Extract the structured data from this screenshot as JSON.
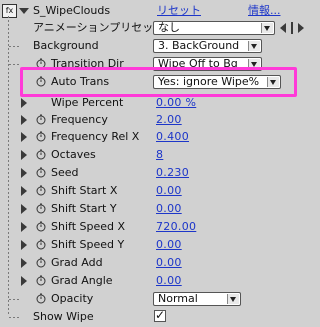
{
  "effect": {
    "name": "S_WipeClouds",
    "reset_label": "リセット",
    "info_label": "情報...",
    "preset_label": "アニメーションプリセット：",
    "preset_value": "なし",
    "nav_icons": [
      "preset-prev-icon",
      "preset-next-icon"
    ]
  },
  "params": {
    "background": {
      "label": "Background",
      "value": "3. BackGround"
    },
    "transition_dir": {
      "label": "Transition Dir",
      "value": "Wipe Off to Bg"
    },
    "auto_trans": {
      "label": "Auto Trans",
      "value": "Yes: ignore Wipe%"
    },
    "wipe_percent": {
      "label": "Wipe Percent",
      "value": "0.00 %"
    },
    "frequency": {
      "label": "Frequency",
      "value": "2.00"
    },
    "frequency_rel_x": {
      "label": "Frequency Rel X",
      "value": "0.400"
    },
    "octaves": {
      "label": "Octaves",
      "value": "8"
    },
    "seed": {
      "label": "Seed",
      "value": "0.230"
    },
    "shift_start_x": {
      "label": "Shift Start X",
      "value": "0.00"
    },
    "shift_start_y": {
      "label": "Shift Start Y",
      "value": "0.00"
    },
    "shift_speed_x": {
      "label": "Shift Speed X",
      "value": "720.00"
    },
    "shift_speed_y": {
      "label": "Shift Speed Y",
      "value": "0.00"
    },
    "grad_add": {
      "label": "Grad Add",
      "value": "0.00"
    },
    "grad_angle": {
      "label": "Grad Angle",
      "value": "0.00"
    },
    "opacity": {
      "label": "Opacity",
      "value": "Normal"
    },
    "show_wipe": {
      "label": "Show Wipe",
      "checked": true
    }
  },
  "colors": {
    "highlight": "#ff3ad8",
    "value_link": "#1d36c9"
  }
}
